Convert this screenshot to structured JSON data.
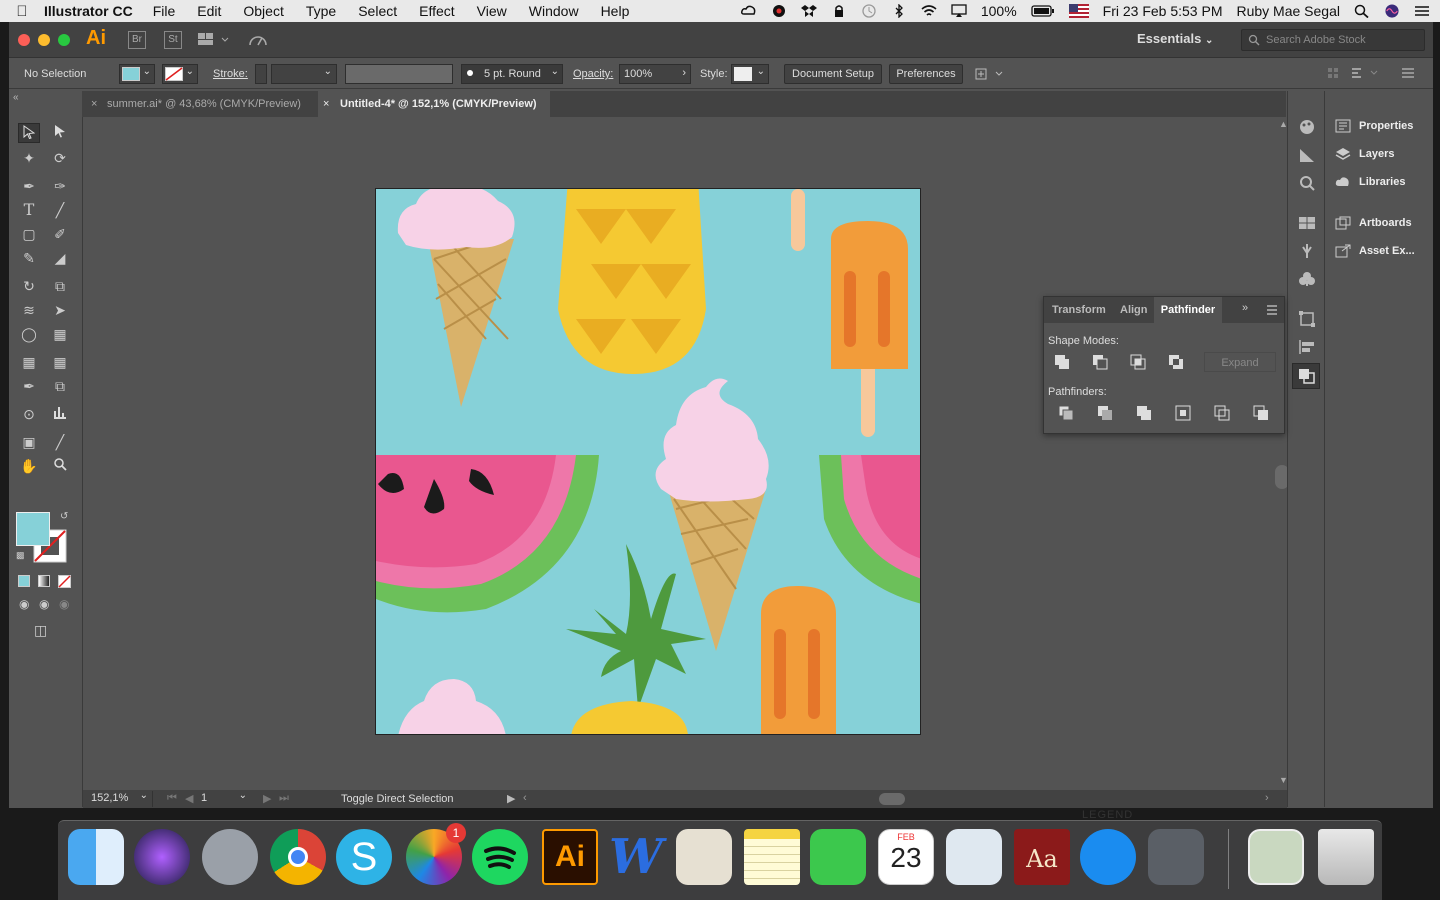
{
  "menubar": {
    "app_name": "Illustrator CC",
    "items": [
      "File",
      "Edit",
      "Object",
      "Type",
      "Select",
      "Effect",
      "View",
      "Window",
      "Help"
    ],
    "battery": "100%",
    "datetime": "Fri 23 Feb  5:53 PM",
    "user": "Ruby Mae Segal"
  },
  "appbar": {
    "logo": "Ai",
    "bridge": "Br",
    "stock": "St",
    "workspace": "Essentials",
    "search_placeholder": "Search Adobe Stock"
  },
  "controlbar": {
    "selection": "No Selection",
    "stroke_label": "Stroke:",
    "brush": "5 pt. Round",
    "opacity_label": "Opacity:",
    "opacity_value": "100%",
    "style_label": "Style:",
    "document_setup": "Document Setup",
    "preferences": "Preferences"
  },
  "tabs": [
    {
      "label": "summer.ai* @ 43,68% (CMYK/Preview)",
      "active": false
    },
    {
      "label": "Untitled-4* @ 152,1% (CMYK/Preview)",
      "active": true
    }
  ],
  "statusbar": {
    "zoom": "152,1%",
    "artboard_number": "1",
    "status_text": "Toggle Direct Selection"
  },
  "dock_panels": {
    "group1": [
      "Properties",
      "Layers",
      "Libraries"
    ],
    "group2": [
      "Artboards",
      "Asset Ex..."
    ]
  },
  "pathfinder_panel": {
    "tabs": [
      "Transform",
      "Align",
      "Pathfinder"
    ],
    "active_tab": "Pathfinder",
    "shape_modes_label": "Shape Modes:",
    "expand_label": "Expand",
    "pathfinders_label": "Pathfinders:"
  },
  "colors": {
    "fill": "#86d1d8",
    "canvas_bg": "#535353",
    "artboard_bg": "#86d1d8"
  },
  "dock": {
    "calendar_month": "FEB",
    "calendar_day": "23",
    "photos_badge": "1",
    "legend_text": "LEGEND"
  }
}
